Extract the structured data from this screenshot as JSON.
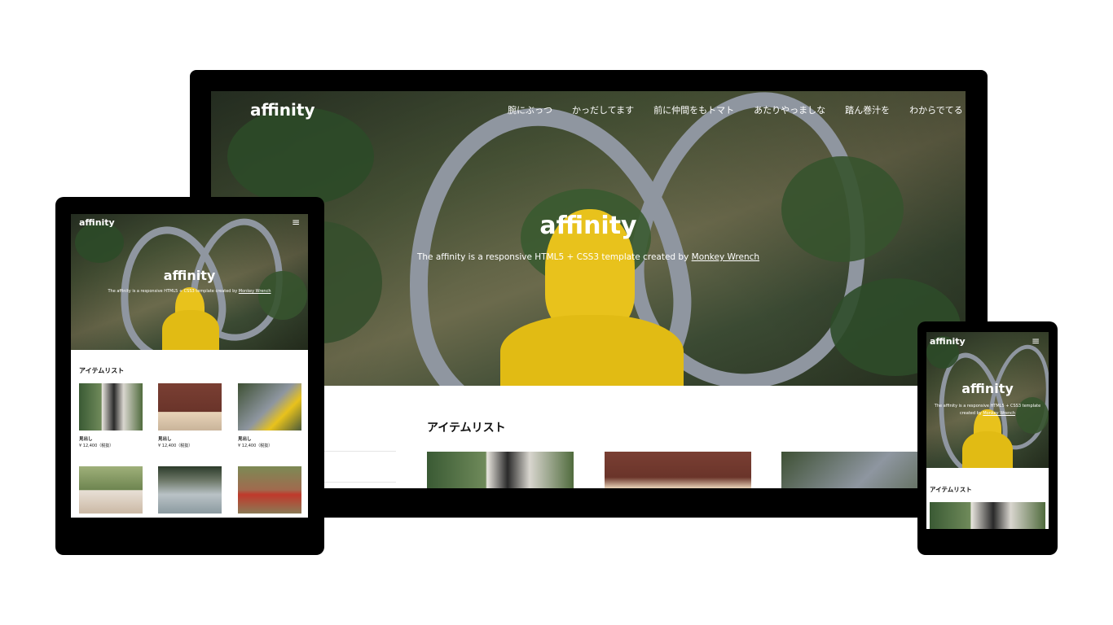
{
  "site": {
    "logo": "affinity",
    "hero_title": "affinity",
    "hero_sub_prefix": "The affinity is a responsive HTML5 + CSS3 template created by ",
    "hero_sub_link": "Monkey Wrench",
    "hero_sub_mobile_line1": "The affinity is a responsive HTML5 + CSS3 template",
    "hero_sub_mobile_line2_prefix": "created by ",
    "menu_icon": "≡"
  },
  "nav": {
    "items": [
      "腕にぶっつ",
      "かっだしてます",
      "前に仲間をもトマト",
      "あたりやっましな",
      "踏ん巻汁を",
      "わからでてる"
    ]
  },
  "section": {
    "title": "アイテムリスト"
  },
  "items": [
    {
      "title": "見出し",
      "price": "¥ 12,400（税抜）"
    },
    {
      "title": "見出し",
      "price": "¥ 12,400（税抜）"
    },
    {
      "title": "見出し",
      "price": "¥ 12,400（税抜）"
    }
  ],
  "colors": {
    "device": "#000000",
    "accent_yellow": "#e8c21c",
    "text_dark": "#111111"
  }
}
